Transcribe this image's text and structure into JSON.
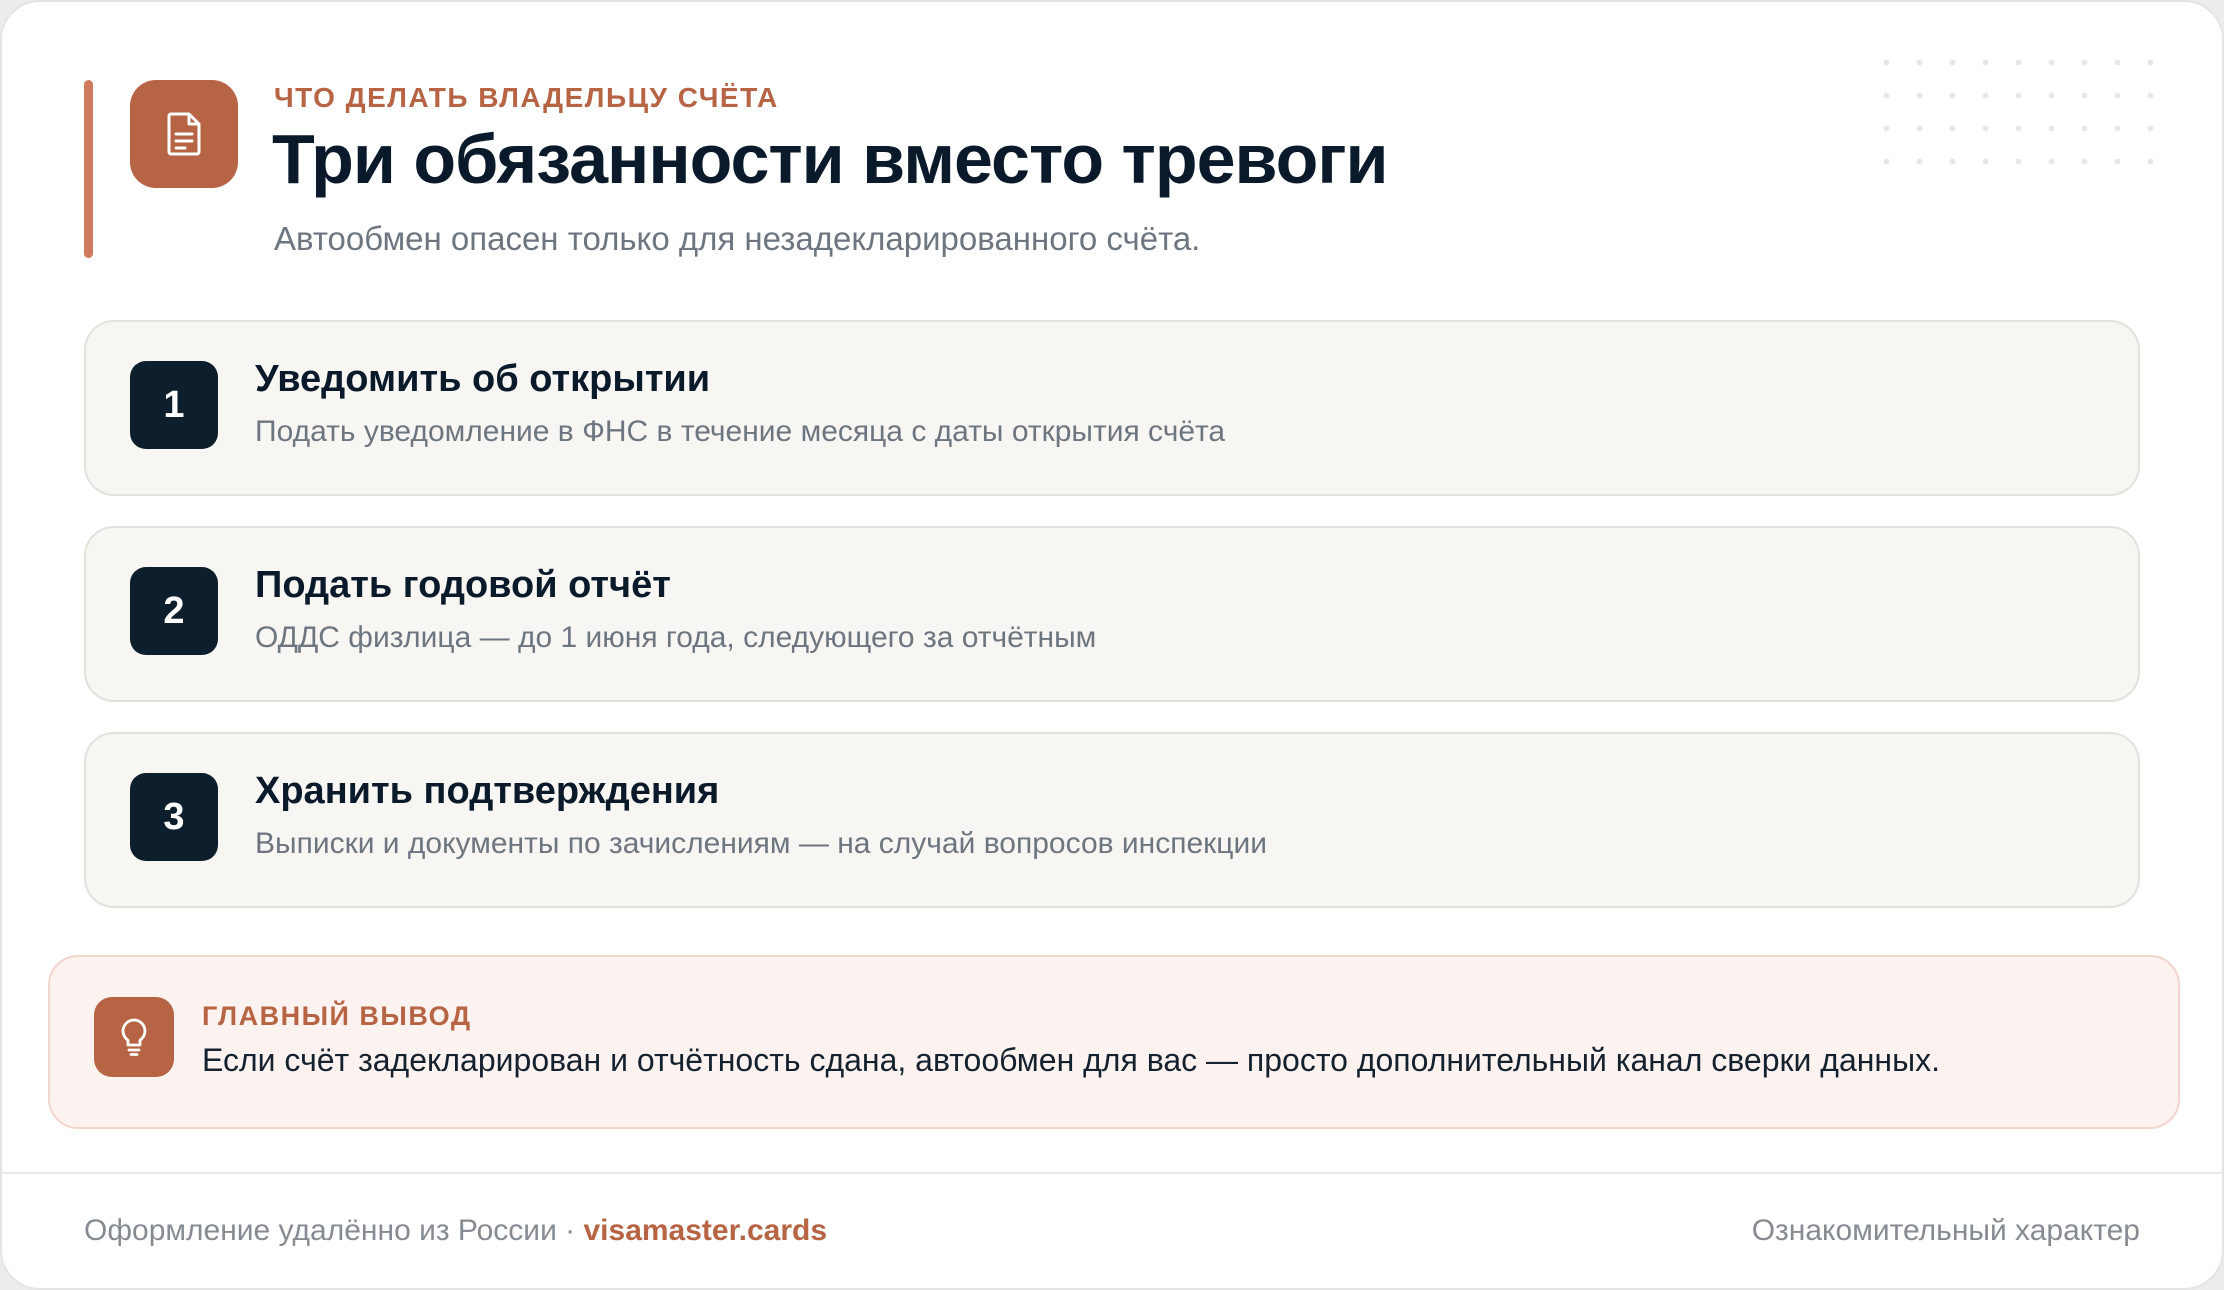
{
  "header": {
    "eyebrow": "ЧТО ДЕЛАТЬ ВЛАДЕЛЬЦУ СЧЁТА",
    "title": "Три обязанности вместо тревоги",
    "subtitle": "Автообмен опасен только для незадекларированного счёта.",
    "icon": "document-icon"
  },
  "steps": [
    {
      "number": "1",
      "title": "Уведомить об открытии",
      "description": "Подать уведомление в ФНС в течение месяца с даты открытия счёта"
    },
    {
      "number": "2",
      "title": "Подать годовой отчёт",
      "description": "ОДДС физлица — до 1 июня года, следующего за отчётным"
    },
    {
      "number": "3",
      "title": "Хранить подтверждения",
      "description": "Выписки и документы по зачислениям — на случай вопросов инспекции"
    }
  ],
  "callout": {
    "icon": "lightbulb-icon",
    "label": "ГЛАВНЫЙ ВЫВОД",
    "text": "Если счёт задекларирован и отчётность сдана, автообмен для вас — просто дополнительный канал сверки данных."
  },
  "footer": {
    "left_text": "Оформление удалённо из России · ",
    "brand": "visamaster.cards",
    "right_text": "Ознакомительный характер"
  },
  "colors": {
    "accent": "#b66443",
    "dark": "#0d1e2c",
    "muted": "#6d7680",
    "step_bg": "#f8f6f2",
    "callout_bg": "#fcf2f0"
  }
}
